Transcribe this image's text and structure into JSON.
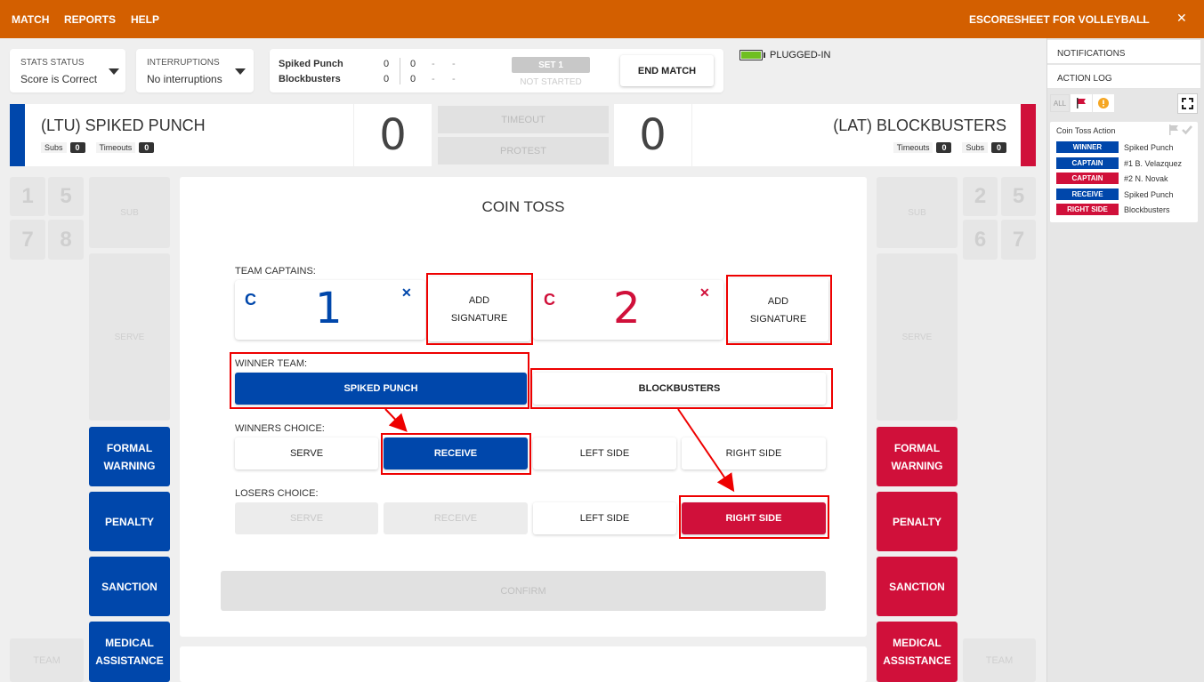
{
  "menu": {
    "match": "MATCH",
    "reports": "REPORTS",
    "help": "HELP"
  },
  "app_title": "ESCORESHEET FOR VOLLEYBALL",
  "window": {
    "minimize": "_",
    "close": "✕"
  },
  "stats_status": {
    "label": "STATS STATUS",
    "value": "Score is Correct"
  },
  "interruptions": {
    "label": "INTERRUPTIONS",
    "value": "No interruptions"
  },
  "scoreboard": {
    "teams": [
      {
        "name": "Spiked Punch",
        "sets": "0",
        "points": "0",
        "d1": "-",
        "d2": "-"
      },
      {
        "name": "Blockbusters",
        "sets": "0",
        "points": "0",
        "d1": "-",
        "d2": "-"
      }
    ],
    "set_label": "SET 1",
    "set_status": "NOT STARTED"
  },
  "end_match": "END MATCH",
  "power": {
    "status": "PLUGGED-IN"
  },
  "home": {
    "name": "(LTU) SPIKED PUNCH",
    "subs_label": "Subs",
    "subs": "0",
    "timeouts_label": "Timeouts",
    "timeouts": "0",
    "score": "0"
  },
  "away": {
    "name": "(LAT) BLOCKBUSTERS",
    "subs_label": "Subs",
    "subs": "0",
    "timeouts_label": "Timeouts",
    "timeouts": "0",
    "score": "0"
  },
  "center_buttons": {
    "timeout": "TIMEOUT",
    "protest": "PROTEST"
  },
  "left_court": {
    "players": [
      "1",
      "5",
      "7",
      "8"
    ],
    "sub": "SUB",
    "serve": "SERVE",
    "team": "TEAM",
    "actions": [
      "FORMAL WARNING",
      "PENALTY",
      "SANCTION",
      "MEDICAL ASSISTANCE"
    ]
  },
  "right_court": {
    "players": [
      "2",
      "5",
      "6",
      "7"
    ],
    "sub": "SUB",
    "serve": "SERVE",
    "team": "TEAM",
    "actions": [
      "FORMAL WARNING",
      "PENALTY",
      "SANCTION",
      "MEDICAL ASSISTANCE"
    ]
  },
  "coin_toss": {
    "title": "COIN TOSS",
    "captains_label": "TEAM CAPTAINS:",
    "home_captain": {
      "c": "C",
      "number": "1",
      "remove": "✕",
      "signature": "ADD SIGNATURE"
    },
    "away_captain": {
      "c": "C",
      "number": "2",
      "remove": "✕",
      "signature": "ADD SIGNATURE"
    },
    "winner_label": "WINNER TEAM:",
    "winner_options": [
      "SPIKED PUNCH",
      "BLOCKBUSTERS"
    ],
    "winners_choice_label": "WINNERS CHOICE:",
    "winners_choice": [
      "SERVE",
      "RECEIVE",
      "LEFT SIDE",
      "RIGHT SIDE"
    ],
    "losers_choice_label": "LOSERS CHOICE:",
    "losers_choice": [
      "SERVE",
      "RECEIVE",
      "LEFT SIDE",
      "RIGHT SIDE"
    ],
    "confirm": "CONFIRM"
  },
  "sidebar": {
    "notifications": "NOTIFICATIONS",
    "action_log": "ACTION LOG",
    "filter_all": "ALL",
    "log_title": "Coin Toss Action",
    "entries": [
      {
        "tag": "WINNER",
        "color": "#0047ab",
        "text": "Spiked Punch"
      },
      {
        "tag": "CAPTAIN",
        "color": "#0047ab",
        "text": "#1 B. Velazquez"
      },
      {
        "tag": "CAPTAIN",
        "color": "#d0103a",
        "text": "#2 N. Novak"
      },
      {
        "tag": "RECEIVE",
        "color": "#0047ab",
        "text": "Spiked Punch"
      },
      {
        "tag": "RIGHT SIDE",
        "color": "#d0103a",
        "text": "Blockbusters"
      }
    ]
  },
  "colors": {
    "home": "#0047ab",
    "away": "#d0103a",
    "topbar": "#d35f00"
  }
}
